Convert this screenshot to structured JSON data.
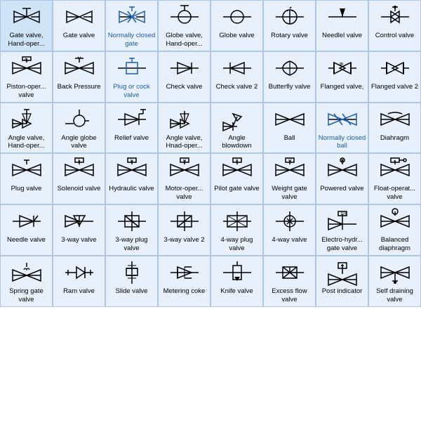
{
  "cells": [
    {
      "label": "Gate valve,\nHand-oper...",
      "icon": "gate_valve_hand"
    },
    {
      "label": "Gate valve",
      "icon": "gate_valve"
    },
    {
      "label": "Normally\nclosed gate",
      "icon": "normally_closed_gate",
      "blue": true
    },
    {
      "label": "Globe valve,\nHand-oper...",
      "icon": "globe_valve_hand"
    },
    {
      "label": "Globe valve",
      "icon": "globe_valve"
    },
    {
      "label": "Rotary valve",
      "icon": "rotary_valve"
    },
    {
      "label": "Needlel valve",
      "icon": "needle_valve_1"
    },
    {
      "label": "Control valve",
      "icon": "control_valve"
    },
    {
      "label": "Piston-oper...\nvalve",
      "icon": "piston_oper"
    },
    {
      "label": "Back\nPressure",
      "icon": "back_pressure"
    },
    {
      "label": "Plug or cock\nvalve",
      "icon": "plug_or_cock",
      "blue": true
    },
    {
      "label": "Check valve",
      "icon": "check_valve"
    },
    {
      "label": "Check valve\n2",
      "icon": "check_valve2"
    },
    {
      "label": "Butterfly\nvalve",
      "icon": "butterfly"
    },
    {
      "label": "Flanged\nvalve,",
      "icon": "flanged"
    },
    {
      "label": "Flanged\nvalve 2",
      "icon": "flanged2"
    },
    {
      "label": "Angle valve,\nHand-oper...",
      "icon": "angle_valve_hand"
    },
    {
      "label": "Angle globe\nvalve",
      "icon": "angle_globe"
    },
    {
      "label": "Relief valve",
      "icon": "relief_valve"
    },
    {
      "label": "Angle valve,\nHnad-oper...",
      "icon": "angle_valve2"
    },
    {
      "label": "Angle\nblowdown",
      "icon": "angle_blowdown"
    },
    {
      "label": "Ball",
      "icon": "ball"
    },
    {
      "label": "Normally\nclosed ball",
      "icon": "normally_closed_ball",
      "blue": true
    },
    {
      "label": "Diahragm",
      "icon": "diaphragm"
    },
    {
      "label": "Plug valve",
      "icon": "plug_valve"
    },
    {
      "label": "Solenoid\nvalve",
      "icon": "solenoid"
    },
    {
      "label": "Hydraulic\nvalve",
      "icon": "hydraulic"
    },
    {
      "label": "Motor-oper...\nvalve",
      "icon": "motor_oper"
    },
    {
      "label": "Pilot gate\nvalve",
      "icon": "pilot_gate"
    },
    {
      "label": "Weight gate\nvalve",
      "icon": "weight_gate"
    },
    {
      "label": "Powered\nvalve",
      "icon": "powered"
    },
    {
      "label": "Float-operat...\nvalve",
      "icon": "float_oper"
    },
    {
      "label": "Needle valve",
      "icon": "needle_valve2"
    },
    {
      "label": "3-way valve",
      "icon": "three_way"
    },
    {
      "label": "3-way plug\nvalve",
      "icon": "three_way_plug"
    },
    {
      "label": "3-way valve 2",
      "icon": "three_way2"
    },
    {
      "label": "4-way plug\nvalve",
      "icon": "four_way_plug"
    },
    {
      "label": "4-way valve",
      "icon": "four_way"
    },
    {
      "label": "Electro-hydr...\ngate valve",
      "icon": "electro_hydr"
    },
    {
      "label": "Balanced\ndiaphragm",
      "icon": "balanced_diaphragm"
    },
    {
      "label": "Spring gate\nvalve",
      "icon": "spring_gate"
    },
    {
      "label": "Ram valve",
      "icon": "ram_valve"
    },
    {
      "label": "Slide valve",
      "icon": "slide_valve"
    },
    {
      "label": "Metering\ncoke",
      "icon": "metering_coke"
    },
    {
      "label": "Knife valve",
      "icon": "knife_valve"
    },
    {
      "label": "Excess flow\nvalve",
      "icon": "excess_flow"
    },
    {
      "label": "Post\nindicator",
      "icon": "post_indicator"
    },
    {
      "label": "Self draining\nvalve",
      "icon": "self_draining"
    }
  ]
}
